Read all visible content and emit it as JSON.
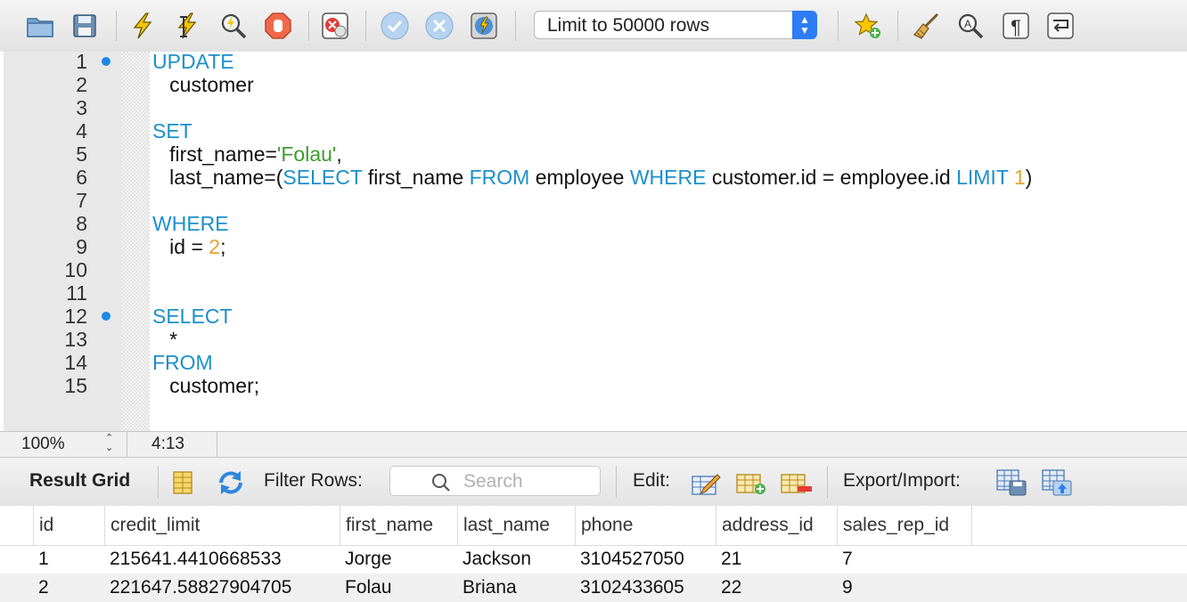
{
  "toolbar": {
    "limit_select": {
      "selected": "Limit to 50000 rows"
    },
    "icons": [
      "folder-open-icon",
      "save-icon",
      "execute-lightning-icon",
      "execute-cursor-lightning-icon",
      "explain-magnifier-icon",
      "stop-icon",
      "toggle-error-stop-icon",
      "commit-check-icon",
      "rollback-x-icon",
      "autocommit-icon",
      "add-snippet-star-icon",
      "beautify-broom-icon",
      "find-magnifier-icon",
      "invisible-chars-pilcrow-icon",
      "word-wrap-icon"
    ]
  },
  "editor": {
    "lines": [
      {
        "n": "1",
        "marker": true,
        "tokens": [
          {
            "t": "kw",
            "v": "UPDATE"
          }
        ]
      },
      {
        "n": "2",
        "marker": false,
        "tokens": [
          {
            "t": "plain",
            "v": "   customer"
          }
        ]
      },
      {
        "n": "3",
        "marker": false,
        "tokens": []
      },
      {
        "n": "4",
        "marker": false,
        "tokens": [
          {
            "t": "kw",
            "v": "SET"
          }
        ]
      },
      {
        "n": "5",
        "marker": false,
        "tokens": [
          {
            "t": "plain",
            "v": "   first_name="
          },
          {
            "t": "str",
            "v": "'Folau'"
          },
          {
            "t": "plain",
            "v": ","
          }
        ]
      },
      {
        "n": "6",
        "marker": false,
        "tokens": [
          {
            "t": "plain",
            "v": "   last_name=("
          },
          {
            "t": "kw",
            "v": "SELECT"
          },
          {
            "t": "plain",
            "v": " first_name "
          },
          {
            "t": "kw",
            "v": "FROM"
          },
          {
            "t": "plain",
            "v": " employee "
          },
          {
            "t": "kw",
            "v": "WHERE"
          },
          {
            "t": "plain",
            "v": " customer.id = employee.id "
          },
          {
            "t": "kw",
            "v": "LIMIT"
          },
          {
            "t": "plain",
            "v": " "
          },
          {
            "t": "num",
            "v": "1"
          },
          {
            "t": "plain",
            "v": ")"
          }
        ]
      },
      {
        "n": "7",
        "marker": false,
        "tokens": []
      },
      {
        "n": "8",
        "marker": false,
        "tokens": [
          {
            "t": "kw",
            "v": "WHERE"
          }
        ]
      },
      {
        "n": "9",
        "marker": false,
        "tokens": [
          {
            "t": "plain",
            "v": "   id = "
          },
          {
            "t": "num",
            "v": "2"
          },
          {
            "t": "plain",
            "v": ";"
          }
        ]
      },
      {
        "n": "10",
        "marker": false,
        "tokens": []
      },
      {
        "n": "11",
        "marker": false,
        "tokens": []
      },
      {
        "n": "12",
        "marker": true,
        "tokens": [
          {
            "t": "kw",
            "v": "SELECT"
          }
        ]
      },
      {
        "n": "13",
        "marker": false,
        "tokens": [
          {
            "t": "plain",
            "v": "   *"
          }
        ]
      },
      {
        "n": "14",
        "marker": false,
        "tokens": [
          {
            "t": "kw",
            "v": "FROM"
          }
        ]
      },
      {
        "n": "15",
        "marker": false,
        "tokens": [
          {
            "t": "plain",
            "v": "   customer;"
          }
        ]
      }
    ]
  },
  "status": {
    "zoom": "100%",
    "cursor": "4:13"
  },
  "result_bar": {
    "title": "Result Grid",
    "filter_label": "Filter Rows:",
    "search_placeholder": "Search",
    "edit_label": "Edit:",
    "export_label": "Export/Import:"
  },
  "grid": {
    "columns": [
      "id",
      "credit_limit",
      "first_name",
      "last_name",
      "phone",
      "address_id",
      "sales_rep_id"
    ],
    "rows": [
      [
        "1",
        "215641.4410668533",
        "Jorge",
        "Jackson",
        "3104527050",
        "21",
        "7"
      ],
      [
        "2",
        "221647.58827904705",
        "Folau",
        "Briana",
        "3102433605",
        "22",
        "9"
      ]
    ]
  },
  "colors": {
    "keyword": "#1c8fcc",
    "string": "#3b9e2a",
    "number": "#e8a32f",
    "marker": "#1e88e5",
    "accent": "#2e7cf6"
  }
}
